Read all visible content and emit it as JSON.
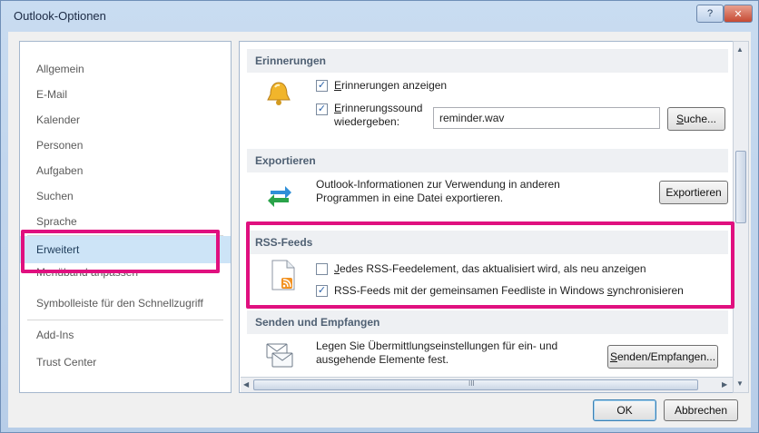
{
  "window": {
    "title": "Outlook-Optionen",
    "help_label": "?",
    "close_label": "✕"
  },
  "nav": {
    "items": [
      {
        "label": "Allgemein"
      },
      {
        "label": "E-Mail"
      },
      {
        "label": "Kalender"
      },
      {
        "label": "Personen"
      },
      {
        "label": "Aufgaben"
      },
      {
        "label": "Suchen"
      },
      {
        "label": "Sprache"
      },
      {
        "label": "Erweitert",
        "selected": true
      },
      {
        "label": "Menüband anpassen"
      },
      {
        "label": "Symbolleiste für den Schnellzugriff"
      },
      {
        "label": "Add-Ins"
      },
      {
        "label": "Trust Center"
      }
    ]
  },
  "sections": {
    "erinnerungen": {
      "header": "Erinnerungen",
      "show_label_pre": "",
      "show_label_u": "E",
      "show_label_post": "rinnerungen anzeigen",
      "show_checked": true,
      "sound_label_u": "E",
      "sound_label_post": "rinnerungssound",
      "sound_label_line2": "wiedergeben:",
      "sound_checked": true,
      "sound_file": "reminder.wav",
      "browse_u": "S",
      "browse_post": "uche..."
    },
    "exportieren": {
      "header": "Exportieren",
      "desc_line1": "Outlook-Informationen zur Verwendung in anderen",
      "desc_line2": "Programmen in eine Datei exportieren.",
      "button": "Exportieren"
    },
    "rss": {
      "header": "RSS-Feeds",
      "opt1_u": "J",
      "opt1_post": "edes RSS-Feedelement, das aktualisiert wird, als neu anzeigen",
      "opt1_checked": false,
      "opt2_pre": "RSS-Feeds mit der gemeinsamen Feedliste in Windows ",
      "opt2_u": "s",
      "opt2_post": "ynchronisieren",
      "opt2_checked": true
    },
    "senden": {
      "header": "Senden und Empfangen",
      "desc_line1": "Legen Sie Übermittlungseinstellungen für ein- und",
      "desc_line2": "ausgehende Elemente fest.",
      "button_u": "S",
      "button_post": "enden/Empfangen..."
    }
  },
  "footer": {
    "ok": "OK",
    "cancel": "Abbrechen"
  },
  "scrollbar": {
    "grip": "III"
  },
  "colors": {
    "highlight": "#e0107f",
    "selected_nav": "#cde4f7"
  },
  "checkmark": "✓"
}
